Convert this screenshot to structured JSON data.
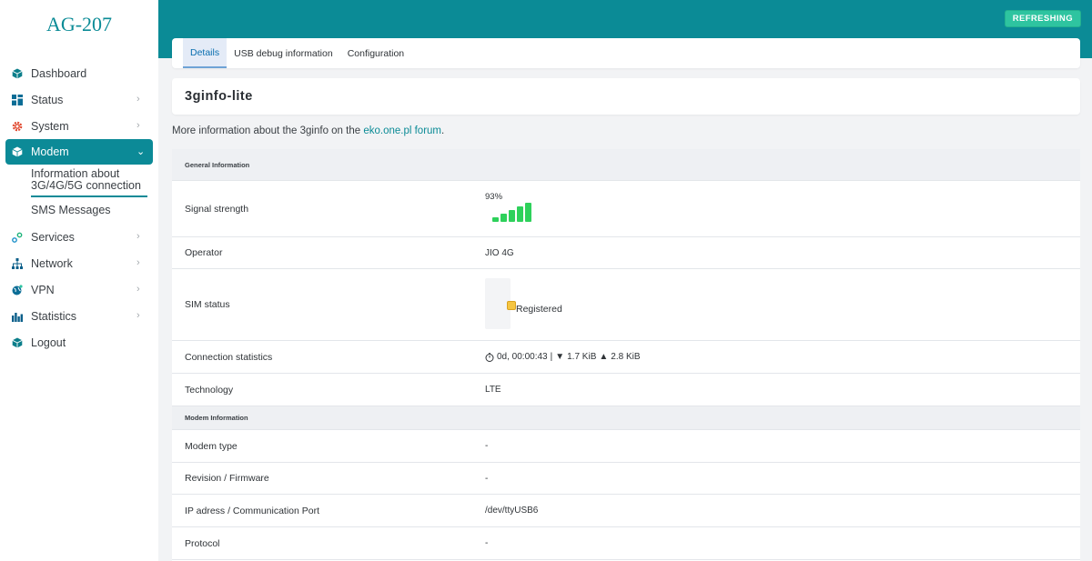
{
  "brand": "AG-207",
  "topbar": {
    "refresh_label": "REFRESHING"
  },
  "nav": {
    "dashboard": "Dashboard",
    "status": "Status",
    "system": "System",
    "modem": "Modem",
    "modem_sub": [
      "Information about 3G/4G/5G connection",
      "SMS Messages"
    ],
    "services": "Services",
    "network": "Network",
    "vpn": "VPN",
    "statistics": "Statistics",
    "logout": "Logout"
  },
  "tabs": [
    "Details",
    "USB debug information",
    "Configuration"
  ],
  "page_title": "3ginfo-lite",
  "info": {
    "prefix": "More information about the 3ginfo on the ",
    "link": "eko.one.pl forum",
    "suffix": "."
  },
  "general": {
    "header": "General Information",
    "signal_label": "Signal strength",
    "signal_value": "93%",
    "signal_bars": 5,
    "operator_label": "Operator",
    "operator_value": "JIO 4G",
    "sim_label": "SIM status",
    "sim_value": "Registered",
    "conn_label": "Connection statistics",
    "conn_time": "0d, 00:00:43",
    "conn_sep": "|",
    "conn_down": "1.7 KiB",
    "conn_up": "2.8 KiB",
    "tech_label": "Technology",
    "tech_value": "LTE"
  },
  "modem": {
    "header": "Modem Information",
    "type_label": "Modem type",
    "type_value": "-",
    "rev_label": "Revision / Firmware",
    "rev_value": "-",
    "ip_label": "IP adress / Communication Port",
    "ip_value": "/dev/ttyUSB6",
    "proto_label": "Protocol",
    "proto_value": "-"
  },
  "colors": {
    "accent": "#0b8b96",
    "signal": "#2ed15b",
    "refresh": "#2ec4a0"
  }
}
